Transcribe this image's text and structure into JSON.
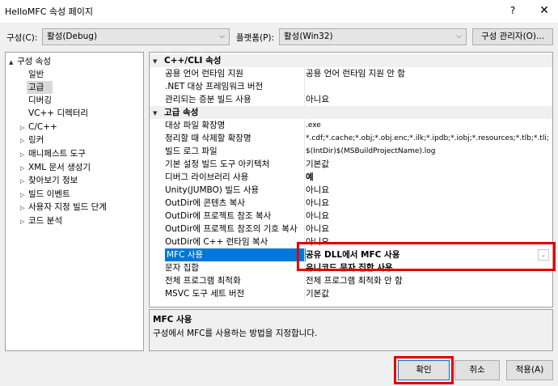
{
  "window": {
    "title": "HelloMFC 속성 페이지",
    "help_glyph": "?",
    "close_glyph": "✕"
  },
  "config": {
    "config_label": "구성(C):",
    "config_value": "활성(Debug)",
    "platform_label": "플랫폼(P):",
    "platform_value": "활성(Win32)",
    "manager_button": "구성 관리자(O)..."
  },
  "tree": {
    "items": [
      {
        "label": "구성 속성",
        "expander": "▲"
      },
      {
        "label": "일반",
        "expander": ""
      },
      {
        "label": "고급",
        "expander": ""
      },
      {
        "label": "디버깅",
        "expander": ""
      },
      {
        "label": "VC++ 디렉터리",
        "expander": ""
      },
      {
        "label": "C/C++",
        "expander": "▷"
      },
      {
        "label": "링커",
        "expander": "▷"
      },
      {
        "label": "매니페스트 도구",
        "expander": "▷"
      },
      {
        "label": "XML 문서 생성기",
        "expander": "▷"
      },
      {
        "label": "찾아보기 정보",
        "expander": "▷"
      },
      {
        "label": "빌드 이벤트",
        "expander": "▷"
      },
      {
        "label": "사용자 지정 빌드 단계",
        "expander": "▷"
      },
      {
        "label": "코드 분석",
        "expander": "▷"
      }
    ]
  },
  "grid": {
    "cat1": {
      "label": "C++/CLI 속성",
      "expander": "▼"
    },
    "cat1_rows": [
      {
        "name": "공용 언어 런타임 지원",
        "value": "공용 언어 런타임 지원 안 함"
      },
      {
        "name": ".NET 대상 프레임워크 버전",
        "value": ""
      },
      {
        "name": "관리되는 증분 빌드 사용",
        "value": "아니요"
      }
    ],
    "cat2": {
      "label": "고급 속성",
      "expander": "▼"
    },
    "cat2_rows": [
      {
        "name": "대상 파일 확장명",
        "value": ".exe"
      },
      {
        "name": "정리할 때 삭제할 확장명",
        "value": "*.cdf;*.cache;*.obj;*.obj.enc;*.ilk;*.ipdb;*.iobj;*.resources;*.tlb;*.tli;"
      },
      {
        "name": "빌드 로그 파일",
        "value": "$(IntDir)$(MSBuildProjectName).log"
      },
      {
        "name": "기본 설정 빌드 도구 아키텍처",
        "value": "기본값"
      },
      {
        "name": "디버그 라이브러리 사용",
        "value": "예"
      },
      {
        "name": "Unity(JUMBO) 빌드 사용",
        "value": "아니요"
      },
      {
        "name": "OutDir에 콘텐츠 복사",
        "value": "아니요"
      },
      {
        "name": "OutDir에 프로젝트 참조 복사",
        "value": "아니요"
      },
      {
        "name": "OutDir에 프로젝트 참조의 기호 복사",
        "value": "아니요"
      },
      {
        "name": "OutDir에 C++ 런타임 복사",
        "value": "아니요"
      },
      {
        "name": "MFC 사용",
        "value": "공유 DLL에서 MFC 사용"
      },
      {
        "name": "문자 집합",
        "value": "유니코드 문자 집합 사용"
      },
      {
        "name": "전체 프로그램 최적화",
        "value": "전체 프로그램 최적화 안 함"
      },
      {
        "name": "MSVC 도구 세트 버전",
        "value": "기본값"
      }
    ],
    "dropdown_glyph": "⌄"
  },
  "description": {
    "title": "MFC 사용",
    "text": "구성에서 MFC를 사용하는 방법을 지정합니다."
  },
  "buttons": {
    "ok": "확인",
    "cancel": "취소",
    "apply": "적용(A)"
  },
  "colors": {
    "highlight_box": "#e00000",
    "selection": "#0078d7"
  }
}
